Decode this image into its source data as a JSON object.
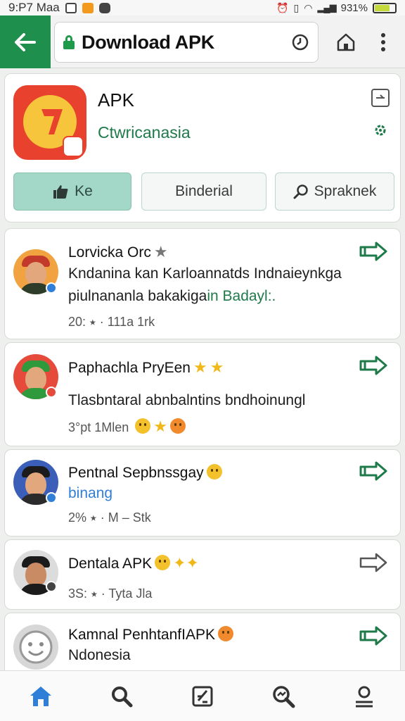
{
  "status": {
    "time": "9:P7 Maa",
    "battery_text": "931% ",
    "battery_pct": 0.7
  },
  "header": {
    "title": "Download APK"
  },
  "app": {
    "name": "APK",
    "subtitle": "Ctwricanasia"
  },
  "actions": {
    "like": "Ke",
    "middle": "Binderial",
    "search": "Spraknek"
  },
  "feed": [
    {
      "name": "Lorvicka Orc",
      "line1": "Kndanina kan Karloannatds Indnaieynkga",
      "line2a": "piulnananla bakakiga",
      "line2b": "in Badayl:.",
      "meta": "20: ⭑ · 111a 1rk"
    },
    {
      "name": "Paphachla PryEen",
      "line1": "Tlasbntaral abnbalntins bndhoinungl",
      "meta": "3°pt  1Mlen"
    },
    {
      "name": "Pentnal Sepbnssgay",
      "line1": "binang",
      "meta": "2% ⭑ · M  –  Stk"
    },
    {
      "name": "Dentala APK",
      "meta": "3S: ⭑ · Tyta Jla"
    },
    {
      "name": "Kamnal PenhtanfIAPK",
      "line1": "Ndonesia"
    }
  ],
  "colors": {
    "brand": "#1f8f4e",
    "accent": "#1f7a4a",
    "nav_active": "#2f7fd8"
  },
  "icons": [
    "back-arrow-icon",
    "lock-icon",
    "clock-icon",
    "home-icon",
    "more-vert-icon",
    "share-arrow-icon",
    "search-icon",
    "home-nav-icon",
    "edit-icon",
    "trending-search-icon",
    "profile-icon"
  ]
}
